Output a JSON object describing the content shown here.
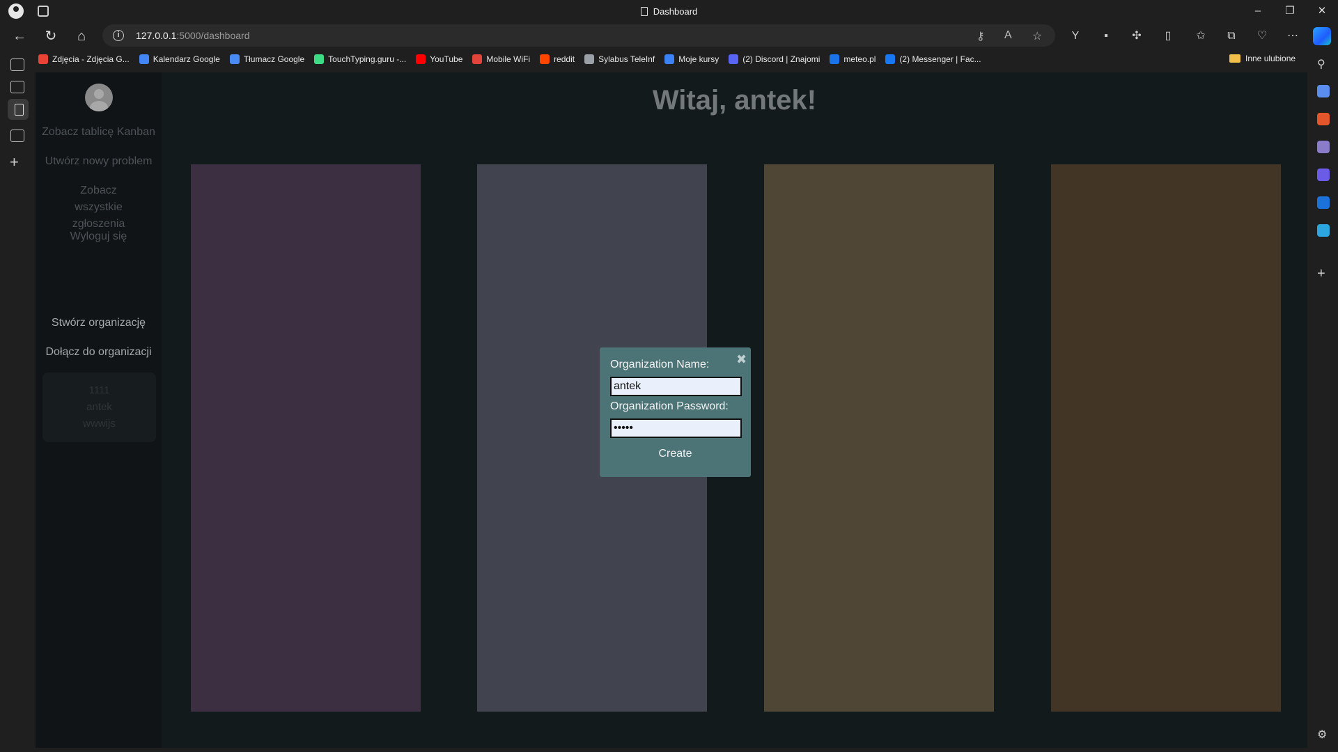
{
  "browser": {
    "tab_title": "Dashboard",
    "url_host": "127.0.0.1",
    "url_rest": ":5000/dashboard",
    "bookmarks": [
      {
        "label": "Zdjęcia - Zdjęcia G...",
        "color": "#ea4335"
      },
      {
        "label": "Kalendarz Google",
        "color": "#4285f4"
      },
      {
        "label": "Tłumacz Google",
        "color": "#4a8af4"
      },
      {
        "label": "TouchTyping.guru -...",
        "color": "#3ddc84"
      },
      {
        "label": "YouTube",
        "color": "#ff0000"
      },
      {
        "label": "Mobile WiFi",
        "color": "#e0443a"
      },
      {
        "label": "reddit",
        "color": "#ff4500"
      },
      {
        "label": "Sylabus TeleInf",
        "color": "#9aa0a6"
      },
      {
        "label": "Moje kursy",
        "color": "#3b82f6"
      },
      {
        "label": "(2) Discord | Znajomi",
        "color": "#5865f2"
      },
      {
        "label": "meteo.pl",
        "color": "#1a73e8"
      },
      {
        "label": "(2) Messenger | Fac...",
        "color": "#1877f2"
      }
    ],
    "other_favorites": "Inne ulubione"
  },
  "sidebar": {
    "links": [
      "Zobacz tablicę Kanban",
      "Utwórz nowy problem",
      "Zobacz wszystkie zgłoszenia",
      "Wyloguj się"
    ],
    "org_actions": [
      "Stwórz organizację",
      "Dołącz do organizacji"
    ],
    "org_card": {
      "id": "1111",
      "owner": "antek",
      "code": "wwwijs"
    }
  },
  "main": {
    "greeting": "Witaj, antek!",
    "columns": [
      {
        "color": "#3d2f42"
      },
      {
        "color": "#41444f"
      },
      {
        "color": "#4f4635"
      },
      {
        "color": "#433525"
      }
    ]
  },
  "modal": {
    "name_label": "Organization Name:",
    "name_value": "antek",
    "password_label": "Organization Password:",
    "password_value": "•••••",
    "create_label": "Create",
    "close_icon": "✖"
  }
}
